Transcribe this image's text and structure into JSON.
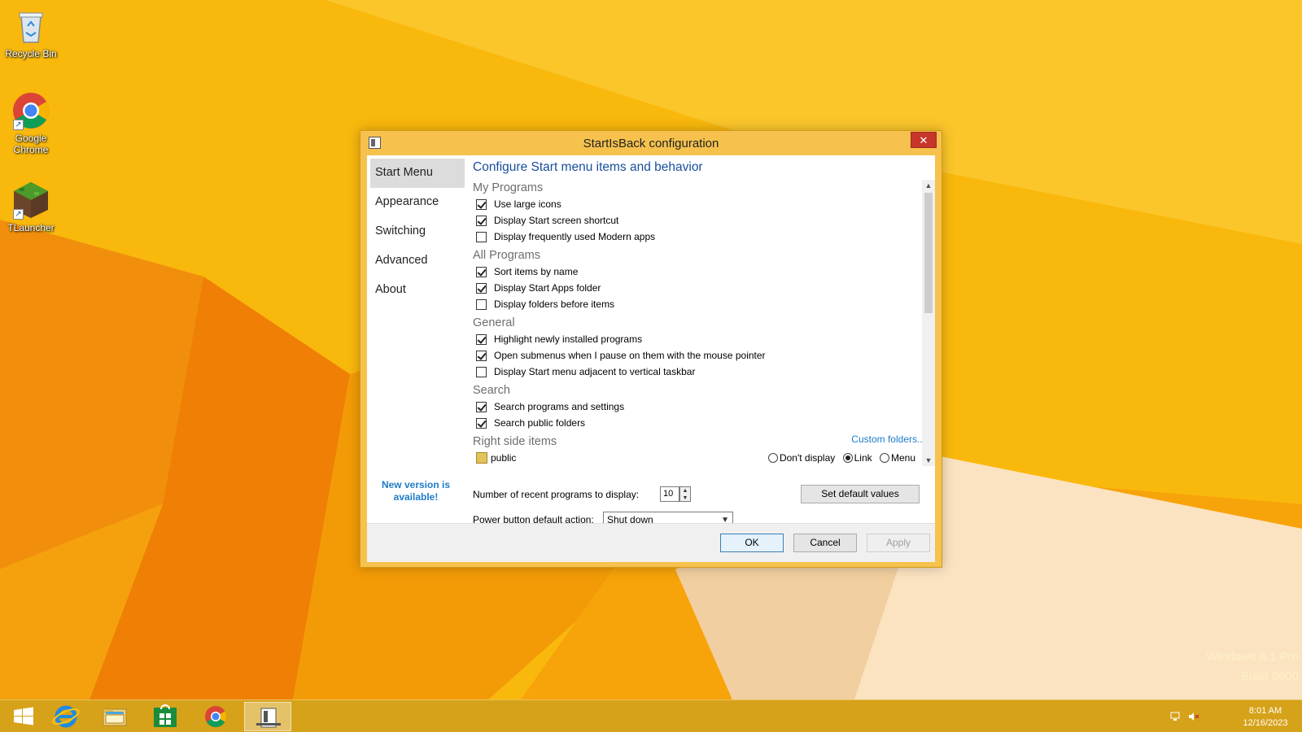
{
  "desktop": {
    "icons": [
      {
        "label": "Recycle Bin"
      },
      {
        "label": "Google Chrome"
      },
      {
        "label": "TLauncher"
      }
    ],
    "watermark": {
      "line1": "Windows 8.1 Pro",
      "line2": "Build 9600"
    }
  },
  "dialog": {
    "title": "StartIsBack configuration",
    "close_glyph": "✕",
    "nav": [
      {
        "label": "Start Menu",
        "active": true
      },
      {
        "label": "Appearance"
      },
      {
        "label": "Switching"
      },
      {
        "label": "Advanced"
      },
      {
        "label": "About"
      }
    ],
    "new_version": "New version is available!",
    "heading": "Configure Start menu items and behavior",
    "sections": {
      "my_programs": {
        "title": "My Programs",
        "items": [
          {
            "label": "Use large icons",
            "checked": true
          },
          {
            "label": "Display Start screen shortcut",
            "checked": true
          },
          {
            "label": "Display frequently used Modern apps",
            "checked": false
          }
        ]
      },
      "all_programs": {
        "title": "All Programs",
        "items": [
          {
            "label": "Sort items by name",
            "checked": true
          },
          {
            "label": "Display Start Apps folder",
            "checked": true
          },
          {
            "label": "Display folders before items",
            "checked": false
          }
        ]
      },
      "general": {
        "title": "General",
        "items": [
          {
            "label": "Highlight newly installed programs",
            "checked": true
          },
          {
            "label": "Open submenus when I pause on them with the mouse pointer",
            "checked": true
          },
          {
            "label": "Display Start menu adjacent to vertical taskbar",
            "checked": false
          }
        ]
      },
      "search": {
        "title": "Search",
        "items": [
          {
            "label": "Search programs and settings",
            "checked": true
          },
          {
            "label": "Search public folders",
            "checked": true
          }
        ]
      },
      "right_side": {
        "title": "Right side items",
        "custom_folders": "Custom folders...",
        "item_label": "public",
        "options": [
          "Don't display",
          "Link",
          "Menu"
        ],
        "selected": "Link"
      }
    },
    "recent_label": "Number of recent programs to display:",
    "recent_value": "10",
    "set_default": "Set default values",
    "power_label": "Power button default action:",
    "power_value": "Shut down",
    "buttons": {
      "ok": "OK",
      "cancel": "Cancel",
      "apply": "Apply"
    }
  },
  "taskbar": {
    "items": [
      "start-icon",
      "internet-explorer-icon",
      "file-explorer-icon",
      "store-icon",
      "chrome-icon",
      "startisback-icon"
    ],
    "time": "8:01 AM",
    "date": "12/16/2023"
  },
  "colors": {
    "accent": "#1a4e9c",
    "link": "#1e7bc8",
    "close": "#c7362a",
    "dialog_frame": "#f6c24d"
  }
}
